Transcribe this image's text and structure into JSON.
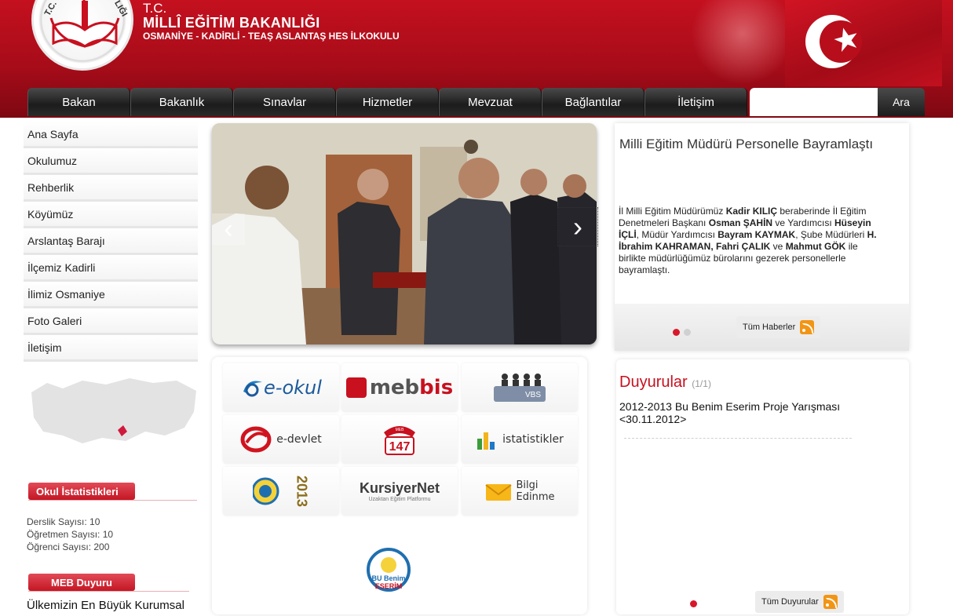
{
  "header": {
    "tc": "T.C.",
    "ministry": "MİLLÎ EĞİTİM BAKANLIĞI",
    "school": "OSMANİYE - KADİRLİ - TEAŞ ASLANTAŞ HES İLKOKULU",
    "logo_letters": [
      "T.C.",
      "LIĞI"
    ]
  },
  "nav": {
    "items": [
      "Bakan",
      "Bakanlık",
      "Sınavlar",
      "Hizmetler",
      "Mevzuat",
      "Bağlantılar",
      "İletişim"
    ],
    "search_placeholder": "",
    "search_button": "Ara"
  },
  "sidebar": {
    "items": [
      "Ana Sayfa",
      "Okulumuz",
      "Rehberlik",
      "Köyümüz",
      "Arslantaş Barajı",
      "İlçemiz Kadirli",
      "İlimiz Osmaniye",
      "Foto Galeri",
      "İletişim"
    ]
  },
  "stats": {
    "title": "Okul İstatistikleri",
    "lines": [
      "Derslik Sayısı: 10",
      "Öğretmen Sayısı: 10",
      "Öğrenci Sayısı: 200"
    ]
  },
  "meb_duyuru": {
    "title": "MEB Duyuru",
    "first_item": "Ülkemizin En Büyük Kurumsal"
  },
  "links": {
    "eokul": "e-okul",
    "mebbis_prefix": "meb",
    "mebbis_suffix": "bis",
    "vbs": "VBS",
    "edevlet": "e-devlet",
    "meb147": "147",
    "meb147_small": "MEB",
    "istatistikler": "istatistikler",
    "bueser_year": "2013",
    "kursiyer": "KursiyerNet",
    "kursiyer_sub": "Uzaktan Eğitim Platformu",
    "bilgi1": "Bilgi",
    "bilgi2": "Edinme",
    "bu_benim": "BU Benim",
    "eserim": "ESERİM"
  },
  "news": {
    "title": "Milli Eğitim Müdürü Personelle Bayramlaştı",
    "body": [
      {
        "t": "İl Milli Eğitim Müdürümüz ",
        "b": false
      },
      {
        "t": "Kadir KILIÇ",
        "b": true
      },
      {
        "t": " beraberinde İl Eğitim Denetmeleri Başkanı ",
        "b": false
      },
      {
        "t": "Osman ŞAHİN",
        "b": true
      },
      {
        "t": " ve Yardımcısı ",
        "b": false
      },
      {
        "t": "Hüseyin İÇLİ",
        "b": true
      },
      {
        "t": ", Müdür Yardımcısı ",
        "b": false
      },
      {
        "t": "Bayram KAYMAK",
        "b": true
      },
      {
        "t": ", Şube Müdürleri ",
        "b": false
      },
      {
        "t": "H. İbrahim KAHRAMAN, Fahri ÇALIK",
        "b": true
      },
      {
        "t": " ve ",
        "b": false
      },
      {
        "t": "Mahmut GÖK",
        "b": true
      },
      {
        "t": " ile birlikte müdürlüğümüz bürolarını gezerek personellerle bayramlaştı.",
        "b": false
      }
    ],
    "more": "Tüm Haberler"
  },
  "announcements": {
    "title": "Duyurular",
    "count": "(1/1)",
    "item": "2012-2013 Bu Benim Eserim Proje Yarışması <30.11.2012>",
    "more": "Tüm Duyurular"
  },
  "colors": {
    "header_red": "#c4101f",
    "nav_dark": "#1c1c1c",
    "accent_red": "#c8101f"
  }
}
